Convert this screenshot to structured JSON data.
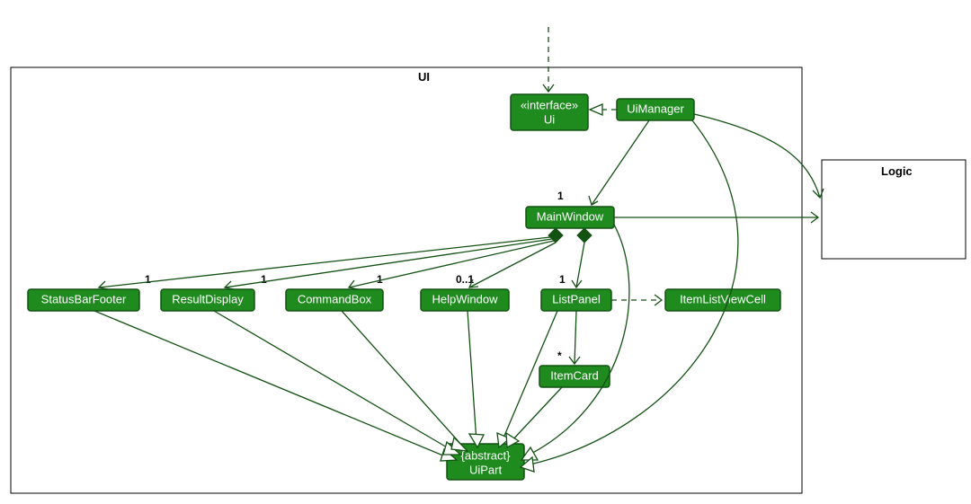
{
  "packages": {
    "ui": {
      "label": "UI"
    },
    "logic": {
      "label": "Logic"
    }
  },
  "nodes": {
    "ui_if": {
      "stereotype": "«interface»",
      "name": "Ui"
    },
    "uimanager": {
      "name": "UiManager"
    },
    "mainwindow": {
      "name": "MainWindow"
    },
    "statusbarfooter": {
      "name": "StatusBarFooter"
    },
    "resultdisplay": {
      "name": "ResultDisplay"
    },
    "commandbox": {
      "name": "CommandBox"
    },
    "helpwindow": {
      "name": "HelpWindow"
    },
    "listpanel": {
      "name": "ListPanel"
    },
    "itemlistviewcell": {
      "name": "ItemListViewCell"
    },
    "itemcard": {
      "name": "ItemCard"
    },
    "uipart": {
      "stereotype": "{abstract}",
      "name": "UiPart"
    }
  },
  "mult": {
    "mw": "1",
    "sbf": "1",
    "rd": "1",
    "cb": "1",
    "hw": "0..1",
    "lp": "1",
    "ic": "*"
  }
}
